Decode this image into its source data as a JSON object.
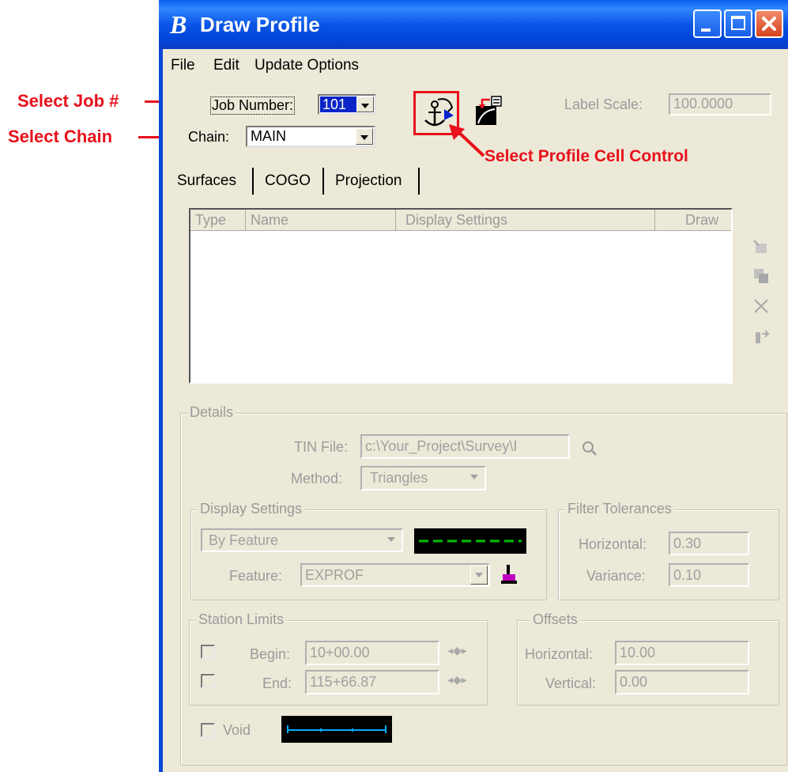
{
  "annotations": {
    "select_job": "Select Job #",
    "select_chain": "Select Chain",
    "select_profile_cell": "Select Profile Cell Control",
    "color": "#e8101b"
  },
  "window": {
    "title": "Draw Profile",
    "controls": [
      "minimize",
      "maximize",
      "close"
    ]
  },
  "menu": [
    "File",
    "Edit",
    "Update Options"
  ],
  "job": {
    "label": "Job Number:",
    "value": "101"
  },
  "chain": {
    "label": "Chain:",
    "value": "MAIN"
  },
  "label_scale": {
    "label": "Label Scale:",
    "value": "100.0000"
  },
  "tabs": [
    "Surfaces",
    "COGO",
    "Projection"
  ],
  "list": {
    "columns": [
      "Type",
      "Name",
      "Display Settings",
      "Draw"
    ]
  },
  "side_icons": [
    "add-icon",
    "copy-icon",
    "delete-icon",
    "export-icon"
  ],
  "details": {
    "title": "Details",
    "tin_label": "TIN File:",
    "tin_value": "c:\\Your_Project\\Survey\\I",
    "method_label": "Method:",
    "method_value": "Triangles"
  },
  "display_settings": {
    "title": "Display Settings",
    "mode": "By Feature",
    "feature_label": "Feature:",
    "feature_value": "EXPROF",
    "line_color": "#00c000"
  },
  "filter": {
    "title": "Filter Tolerances",
    "horizontal_label": "Horizontal:",
    "horizontal_value": "0.30",
    "variance_label": "Variance:",
    "variance_value": "0.10"
  },
  "station_limits": {
    "title": "Station Limits",
    "begin_label": "Begin:",
    "begin_value": "10+00.00",
    "end_label": "End:",
    "end_value": "115+66.87"
  },
  "offsets": {
    "title": "Offsets",
    "horizontal_label": "Horizontal:",
    "horizontal_value": "10.00",
    "vertical_label": "Vertical:",
    "vertical_value": "0.00"
  },
  "void": {
    "label": "Void",
    "line_color": "#00aaff"
  }
}
